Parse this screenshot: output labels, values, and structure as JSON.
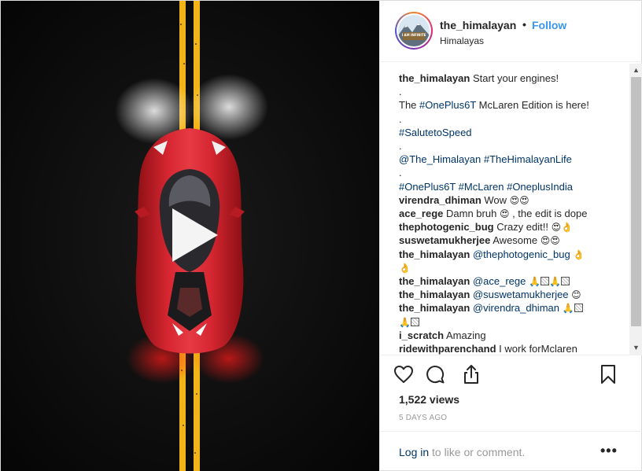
{
  "post": {
    "username": "the_himalayan",
    "header_dot": "•",
    "follow_label": "Follow",
    "location": "Himalayas",
    "avatar_text": "I AM INFINITE"
  },
  "caption": {
    "username": "the_himalayan",
    "text": "Start your engines!",
    "dot1": ".",
    "line2_pre": "The ",
    "line2_tag": "#OnePlus6T",
    "line2_post": " McLaren Edition is here!",
    "dot2": ".",
    "tag_speed": "#SalutetoSpeed",
    "dot3": ".",
    "mention": "@The_Himalayan",
    "tag_life": "#TheHimalayanLife",
    "dot4": ".",
    "tag_1": "#OnePlus6T",
    "tag_2": "#McLaren",
    "tag_3": "#OneplusIndia"
  },
  "comments": [
    {
      "user": "virendra_dhiman",
      "text": "Wow ",
      "mention": "",
      "emoji": "😍😍"
    },
    {
      "user": "ace_rege",
      "text": "Damn bruh ",
      "mention": "",
      "emoji": "😍",
      "text2": " , the edit is dope"
    },
    {
      "user": "thephotogenic_bug",
      "text": "Crazy edit!! ",
      "mention": "",
      "emoji": "😍👌"
    },
    {
      "user": "suswetamukherjee",
      "text": "Awesome ",
      "mention": "",
      "emoji": "😍😍"
    },
    {
      "user": "the_himalayan",
      "text": "",
      "mention": "@thephotogenic_bug",
      "emoji": "👌",
      "emoji_line2": "👌"
    },
    {
      "user": "the_himalayan",
      "text": "",
      "mention": "@ace_rege",
      "emoji": "🙏"
    },
    {
      "user": "the_himalayan",
      "text": "",
      "mention": "@suswetamukherjee",
      "emoji": "😊"
    },
    {
      "user": "the_himalayan",
      "text": "",
      "mention": "@virendra_dhiman",
      "emoji": "🙏",
      "emoji_line2": "🙏"
    },
    {
      "user": "i_scratch",
      "text": "Amazing",
      "mention": "",
      "emoji": ""
    },
    {
      "user": "ridewithparenchand",
      "text": "I work forMclaren",
      "mention": "",
      "emoji": ""
    }
  ],
  "stats": {
    "views": "1,522 views",
    "time": "5 DAYS AGO"
  },
  "login": {
    "link": "Log in",
    "rest": "to like or comment.",
    "more": "•••"
  },
  "icons": [
    "heart-icon",
    "comment-icon",
    "share-icon",
    "bookmark-icon",
    "play-icon",
    "more-icon"
  ],
  "colors": {
    "link": "#003569",
    "follow": "#3897f0",
    "road": "#0b0b0b",
    "lane": "#f2b417",
    "car": "#d0202a"
  }
}
